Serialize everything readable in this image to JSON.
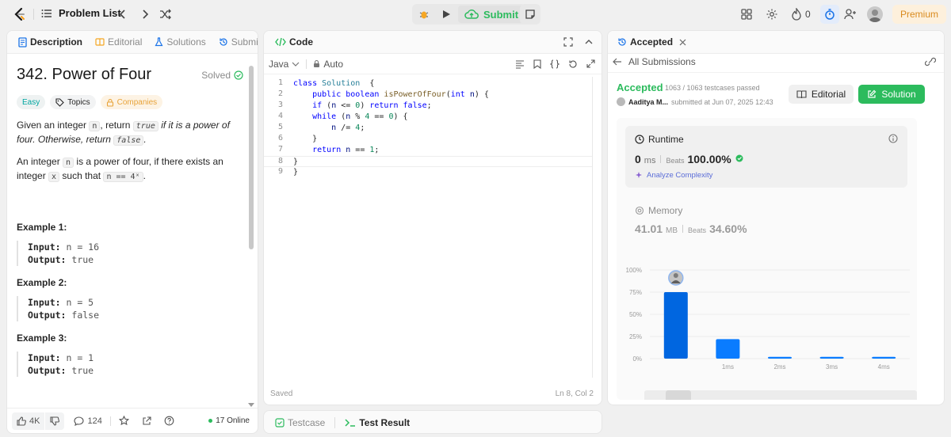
{
  "topbar": {
    "problem_list": "Problem List",
    "submit": "Submit",
    "streak_count": "0",
    "premium": "Premium"
  },
  "left": {
    "tabs": [
      "Description",
      "Editorial",
      "Solutions",
      "Submissio"
    ],
    "title": "342. Power of Four",
    "solved": "Solved",
    "tags": {
      "easy": "Easy",
      "topics": "Topics",
      "companies": "Companies"
    },
    "desc1": {
      "a": "Given an integer ",
      "n": "n",
      "b": ", return ",
      "t": "true",
      "c": " if it is a power of four. Otherwise, return ",
      "f": "false",
      "d": "."
    },
    "desc2": {
      "a": "An integer ",
      "n": "n",
      "b": " is a power of four, if there exists an integer ",
      "x": "x",
      "c": " such that ",
      "eq": "n == 4ˣ",
      "d": "."
    },
    "examples": [
      {
        "title": "Example 1:",
        "input": "n = 16",
        "output": "true"
      },
      {
        "title": "Example 2:",
        "input": "n = 5",
        "output": "false"
      },
      {
        "title": "Example 3:",
        "input": "n = 1",
        "output": "true"
      }
    ],
    "input_label": "Input:",
    "output_label": "Output:",
    "footer": {
      "likes": "4K",
      "comments": "124",
      "online": "17 Online"
    }
  },
  "code": {
    "header": "Code",
    "language": "Java",
    "mode": "Auto",
    "lines": [
      [
        [
          "kw",
          "class "
        ],
        [
          "ty",
          "Solution"
        ],
        [
          "",
          "  {"
        ]
      ],
      [
        [
          "",
          "    "
        ],
        [
          "kw",
          "public "
        ],
        [
          "kw",
          "boolean "
        ],
        [
          "fn",
          "isPowerOfFour"
        ],
        [
          "",
          "("
        ],
        [
          "kw",
          "int "
        ],
        [
          "tx",
          "n"
        ],
        [
          "",
          ") {"
        ]
      ],
      [
        [
          "",
          "    "
        ],
        [
          "kw",
          "if "
        ],
        [
          "",
          "("
        ],
        [
          "tx",
          "n "
        ],
        [
          "",
          "<= "
        ],
        [
          "num",
          "0"
        ],
        [
          "",
          ") "
        ],
        [
          "kw",
          "return "
        ],
        [
          "kw",
          "false"
        ],
        [
          "",
          ";"
        ]
      ],
      [
        [
          "",
          "    "
        ],
        [
          "kw",
          "while "
        ],
        [
          "",
          "("
        ],
        [
          "tx",
          "n "
        ],
        [
          "",
          "% "
        ],
        [
          "num",
          "4 "
        ],
        [
          "",
          "== "
        ],
        [
          "num",
          "0"
        ],
        [
          "",
          ") {"
        ]
      ],
      [
        [
          "",
          "        "
        ],
        [
          "tx",
          "n "
        ],
        [
          "",
          "/= "
        ],
        [
          "num",
          "4"
        ],
        [
          "",
          ";"
        ]
      ],
      [
        [
          "",
          "    }"
        ]
      ],
      [
        [
          "",
          "    "
        ],
        [
          "kw",
          "return "
        ],
        [
          "tx",
          "n "
        ],
        [
          "",
          "== "
        ],
        [
          "num",
          "1"
        ],
        [
          "",
          ";"
        ]
      ],
      [
        [
          "",
          "}"
        ]
      ],
      [
        [
          "",
          "}"
        ]
      ]
    ],
    "status_left": "Saved",
    "status_right": "Ln 8, Col 2",
    "bottom_tabs": {
      "testcase": "Testcase",
      "result": "Test Result"
    }
  },
  "result": {
    "tab": "Accepted",
    "all_submissions": "All Submissions",
    "accepted": "Accepted",
    "testcases": "1063 / 1063 testcases passed",
    "user": "Aaditya M...",
    "submitted": "submitted at Jun 07, 2025 12:43",
    "editorial_btn": "Editorial",
    "solution_btn": "Solution",
    "runtime": {
      "label": "Runtime",
      "value": "0",
      "unit": "ms",
      "beats": "Beats",
      "pct": "100.00%",
      "analyze": "Analyze Complexity"
    },
    "memory": {
      "label": "Memory",
      "value": "41.01",
      "unit": "MB",
      "beats": "Beats",
      "pct": "34.60%"
    }
  },
  "chart_data": {
    "type": "bar",
    "categories": [
      "",
      "1ms",
      "2ms",
      "3ms",
      "4ms"
    ],
    "values": [
      75,
      22,
      2,
      2,
      2
    ],
    "ylim": [
      0,
      100
    ],
    "yticks": [
      "100%",
      "75%",
      "50%",
      "25%",
      "0%"
    ],
    "ytick_values": [
      100,
      75,
      50,
      25,
      0
    ],
    "bar_color": "#0a7cff",
    "highlight_index": 0
  },
  "colors": {
    "accent_green": "#2cbb5d",
    "link_blue": "#007aff",
    "premium": "#d98a1d"
  }
}
